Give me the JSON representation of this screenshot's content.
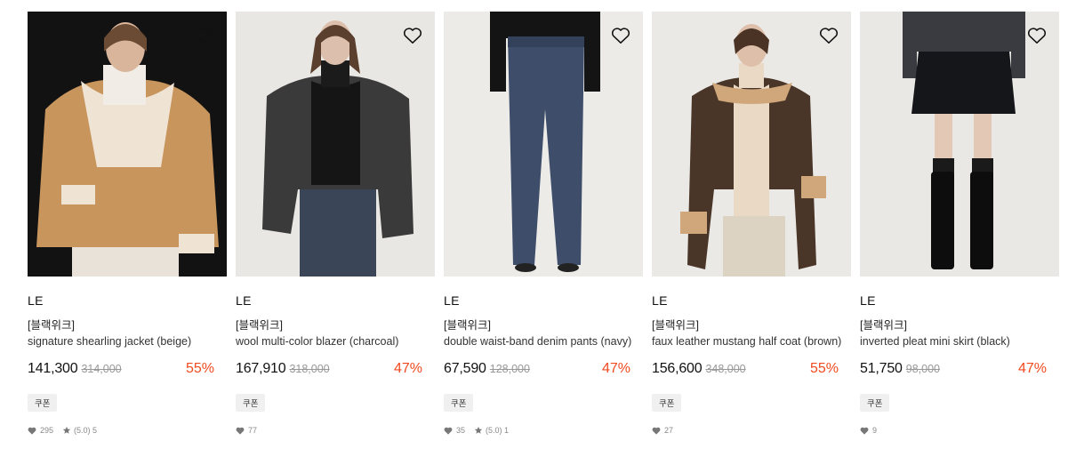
{
  "products": [
    {
      "brand": "LE",
      "tag": "[블랙위크]",
      "name": "signature shearling jacket (beige)",
      "price": "141,300",
      "original_price": "314,000",
      "discount": "55%",
      "coupon": "쿠폰",
      "likes": "295",
      "rating": "(5.0) 5"
    },
    {
      "brand": "LE",
      "tag": "[블랙위크]",
      "name": "wool multi-color blazer (charcoal)",
      "price": "167,910",
      "original_price": "318,000",
      "discount": "47%",
      "coupon": "쿠폰",
      "likes": "77"
    },
    {
      "brand": "LE",
      "tag": "[블랙위크]",
      "name": "double waist-band denim pants (navy)",
      "price": "67,590",
      "original_price": "128,000",
      "discount": "47%",
      "coupon": "쿠폰",
      "likes": "35",
      "rating": "(5.0) 1"
    },
    {
      "brand": "LE",
      "tag": "[블랙위크]",
      "name": "faux leather mustang half coat (brown)",
      "price": "156,600",
      "original_price": "348,000",
      "discount": "55%",
      "coupon": "쿠폰",
      "likes": "27"
    },
    {
      "brand": "LE",
      "tag": "[블랙위크]",
      "name": "inverted pleat mini skirt (black)",
      "price": "51,750",
      "original_price": "98,000",
      "discount": "47%",
      "coupon": "쿠폰",
      "likes": "9"
    }
  ],
  "colors": {
    "discount": "#f04a1f",
    "coupon_bg": "#f0f0f0"
  }
}
